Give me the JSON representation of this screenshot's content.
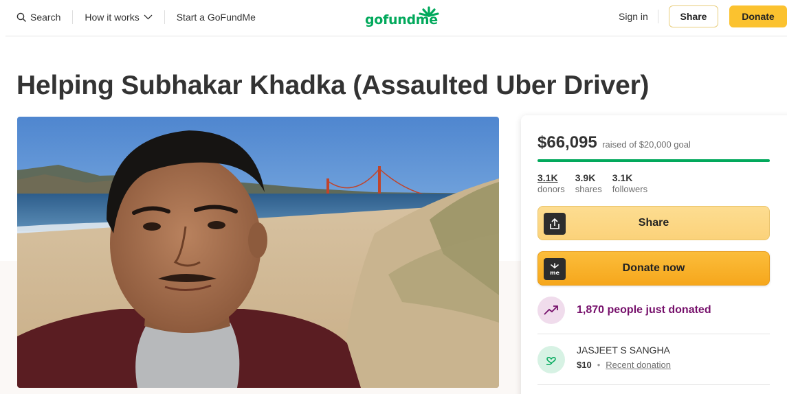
{
  "header": {
    "search_label": "Search",
    "how_it_works_label": "How it works",
    "start_label": "Start a GoFundMe",
    "logo_text": "gofundme",
    "signin_label": "Sign in",
    "share_label": "Share",
    "donate_label": "Donate"
  },
  "campaign": {
    "title": "Helping Subhakar Khadka (Assaulted Uber Driver)",
    "hero_icon": "campaign-photo"
  },
  "card": {
    "raised_amount": "$66,095",
    "goal_text": "raised of $20,000 goal",
    "progress_fraction": 1.0,
    "stats": [
      {
        "value": "3.1K",
        "label": "donors"
      },
      {
        "value": "3.9K",
        "label": "shares"
      },
      {
        "value": "3.1K",
        "label": "followers"
      }
    ],
    "share_button": "Share",
    "donate_button": "Donate now",
    "recent_count_text": "1,870 people just donated",
    "donor": {
      "name": "JASJEET S SANGHA",
      "amount": "$10",
      "tag": "Recent donation"
    }
  },
  "colors": {
    "brand_green": "#02a95c",
    "donate_yellow": "#fbc22f",
    "recent_purple": "#76106b"
  }
}
